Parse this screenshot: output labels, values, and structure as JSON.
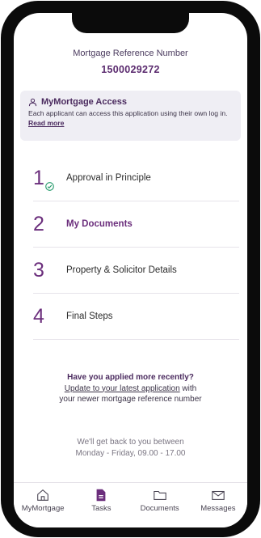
{
  "header": {
    "ref_label": "Mortgage Reference Number",
    "ref_number": "1500029272"
  },
  "access": {
    "title": "MyMortgage Access",
    "text": "Each applicant can access this application using their own log in.",
    "link": "Read more"
  },
  "steps": [
    {
      "number": "1",
      "label": "Approval in Principle",
      "completed": true
    },
    {
      "number": "2",
      "label": "My Documents",
      "active": true
    },
    {
      "number": "3",
      "label": "Property & Solicitor Details"
    },
    {
      "number": "4",
      "label": "Final Steps"
    }
  ],
  "help": {
    "question": "Have you applied more recently?",
    "link": "Update to your latest application",
    "link_suffix": " with",
    "line3": "your newer mortgage reference number"
  },
  "hours": {
    "line1": "We'll get back to you between",
    "line2": "Monday - Friday, 09.00 - 17.00"
  },
  "tabs": [
    {
      "label": "MyMortgage",
      "icon": "home-icon"
    },
    {
      "label": "Tasks",
      "icon": "document-icon",
      "active": true
    },
    {
      "label": "Documents",
      "icon": "folder-icon"
    },
    {
      "label": "Messages",
      "icon": "mail-icon"
    }
  ],
  "colors": {
    "accent": "#6b2e7c",
    "check": "#2a9d6f"
  }
}
